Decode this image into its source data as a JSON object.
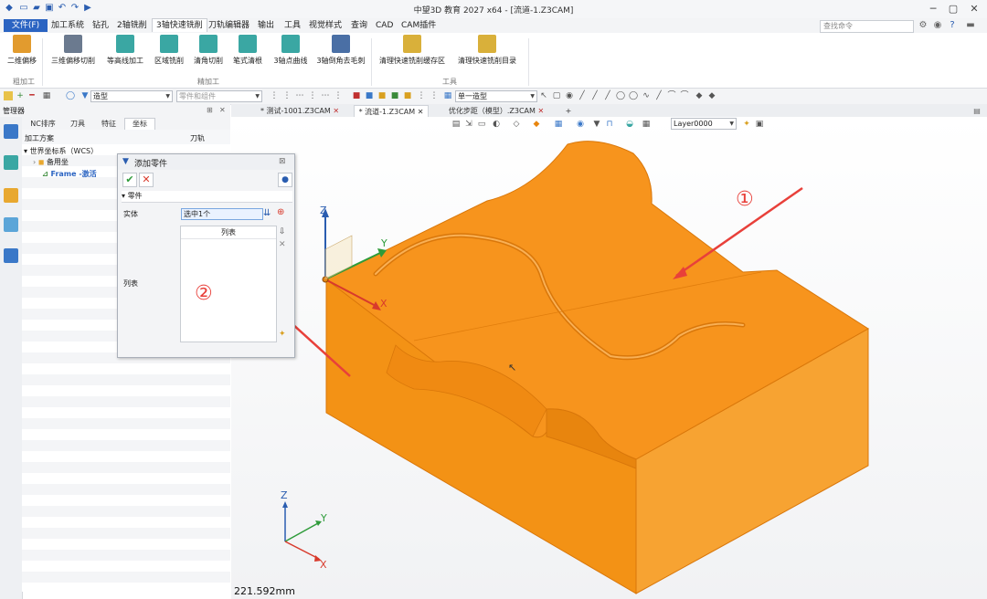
{
  "app": {
    "title": "中望3D 教育 2027 x64 - [流道-1.Z3CAM]"
  },
  "menu": {
    "file": "文件(F)",
    "items": [
      "加工系统",
      "钻孔",
      "2轴铣削",
      "3轴快速铣削",
      "刀轨编辑器",
      "输出",
      "工具",
      "视觉样式",
      "查询",
      "CAD",
      "CAM插件"
    ],
    "search_placeholder": "查找命令"
  },
  "ribbon": {
    "buttons": [
      {
        "label": "二维偏移"
      },
      {
        "label": "三维偏移切削"
      },
      {
        "label": "等高线加工"
      },
      {
        "label": "区域铣削"
      },
      {
        "label": "清角切削"
      },
      {
        "label": "笔式清根"
      },
      {
        "label": "3轴点曲线"
      },
      {
        "label": "3轴倒角去毛刺"
      },
      {
        "label": "清理快速铣削缓存区"
      },
      {
        "label": "清理快速铣削目录"
      }
    ],
    "groups": [
      "粗加工",
      "精加工",
      "工具"
    ]
  },
  "toolbar": {
    "filter_combo": "造型",
    "filter_combo2": "零件和组件",
    "selection_combo": "单一造型",
    "layer_combo": "Layer0000"
  },
  "manager": {
    "title": "管理器",
    "tabs": [
      "NC排序",
      "刀具",
      "特征",
      "坐标"
    ],
    "columns": {
      "plan": "加工方案",
      "toolpath": "刀轨"
    },
    "tree": {
      "root": "世界坐标系（WCS）",
      "child1": "备用坐",
      "child2": "Frame -激活"
    }
  },
  "doc_tabs": [
    "* 测试-1001.Z3CAM",
    "* 流道-1.Z3CAM",
    "优化步距（模型）.Z3CAM"
  ],
  "dialog": {
    "title": "添加零件",
    "section": "零件",
    "entity_label": "实体",
    "entity_value": "选中1个",
    "list_header": "列表",
    "list_label": "列表"
  },
  "annotations": {
    "one": "①",
    "two": "②"
  },
  "axis": {
    "z": "Z",
    "x": "X",
    "y": "Y"
  },
  "status": {
    "distance": "221.592mm"
  },
  "colors": {
    "model": "#f7941d",
    "model_edge": "#d9770a",
    "arrow": "#e8403a",
    "accent": "#2b64c2"
  }
}
